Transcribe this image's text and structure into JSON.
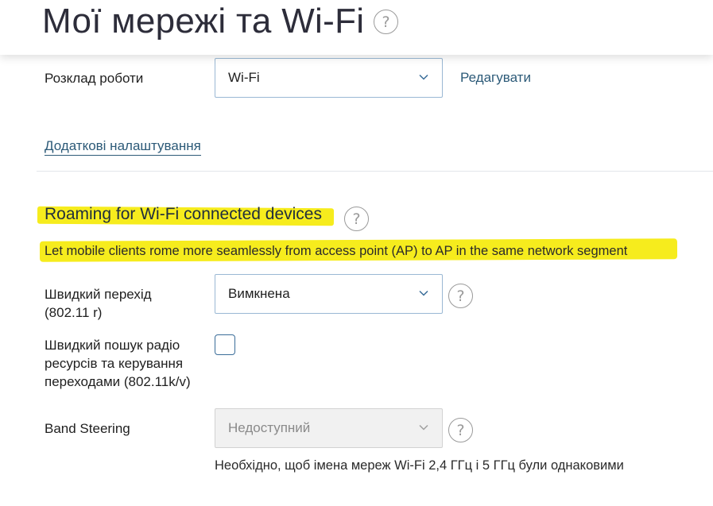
{
  "header": {
    "title": "Мої мережі та Wi-Fi",
    "help_symbol": "?"
  },
  "schedule": {
    "label": "Розклад роботи",
    "value": "Wi-Fi",
    "edit_link": "Редагувати"
  },
  "advanced_link": "Додаткові налаштування",
  "roaming": {
    "title": "Roaming for Wi-Fi connected devices",
    "description": "Let mobile clients rome more seamlessly from access point (AP) to AP in the same network segment",
    "highlight_color": "#f6ec1d"
  },
  "fast_transition": {
    "label_line1": "Швидкий перехід",
    "label_line2": "(802.11 r)",
    "value": "Вимкнена"
  },
  "radio_search": {
    "label_line1": "Швидкий пошук радіо",
    "label_line2": "ресурсів та керування",
    "label_line3": "переходами (802.11k/v)",
    "checked": false
  },
  "band_steering": {
    "label": "Band Steering",
    "value": "Недоступний",
    "note": "Необхідно, щоб імена мереж Wi-Fi 2,4 ГГц і 5 ГГц були однаковими"
  },
  "icons": {
    "help": "question-circle-icon",
    "chevron": "chevron-down-icon"
  },
  "colors": {
    "link": "#2c5a78",
    "select_border": "#9ab8d4",
    "checkbox_border": "#3a6d99"
  }
}
